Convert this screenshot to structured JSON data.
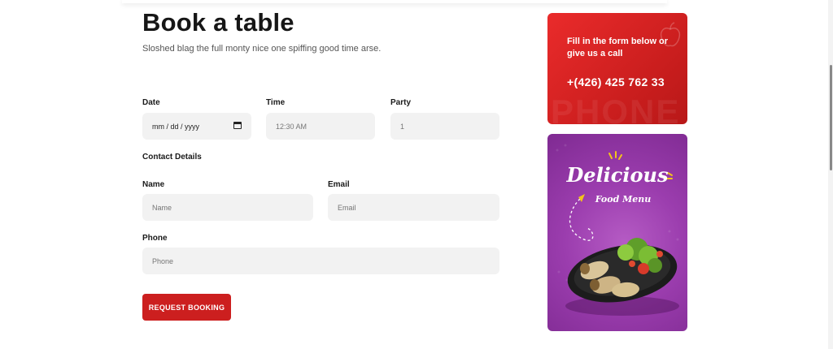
{
  "header": {
    "title": "Book a table",
    "subtitle": "Sloshed blag the full monty nice one spiffing good time arse."
  },
  "form": {
    "date_label": "Date",
    "date_value": "mm / dd / yyyy",
    "time_label": "Time",
    "time_value": "12:30 AM",
    "party_label": "Party",
    "party_value": "1",
    "contact_heading": "Contact Details",
    "name_label": "Name",
    "name_placeholder": "Name",
    "email_label": "Email",
    "email_placeholder": "Email",
    "phone_label": "Phone",
    "phone_placeholder": "Phone",
    "submit_label": "REQUEST BOOKING"
  },
  "promo_call": {
    "message": "Fill in the form below or give us a call",
    "phone_number": "+(426) 425 762 33",
    "watermark": "PHONE"
  },
  "promo_menu": {
    "headline": "Delicious",
    "subline": "Food Menu"
  },
  "colors": {
    "accent": "#cc1f1f",
    "field_bg": "#f2f2f2",
    "menu_purple": "#9b3dae"
  }
}
